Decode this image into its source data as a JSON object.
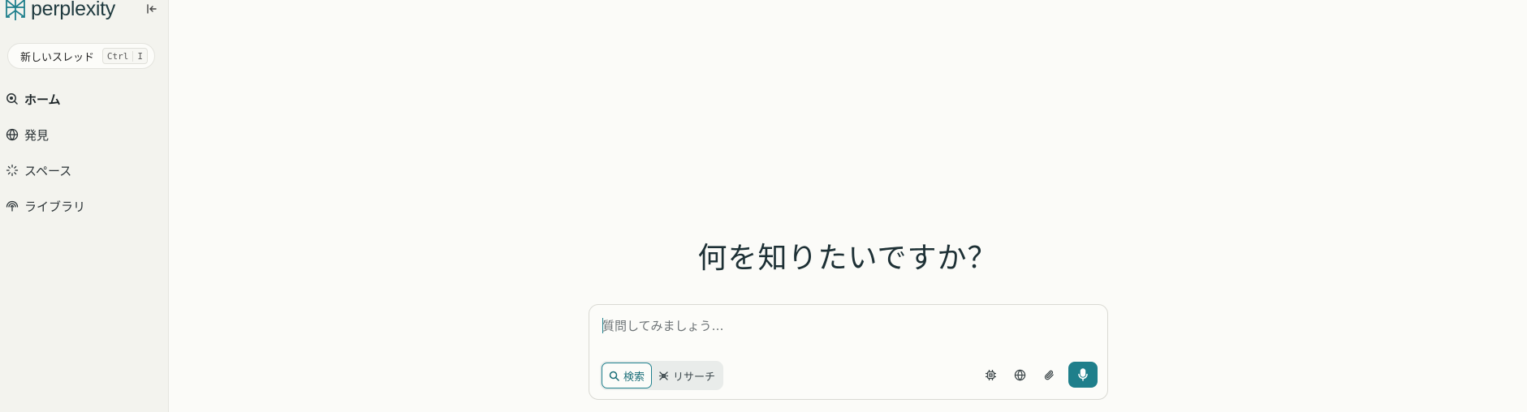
{
  "brand": {
    "name": "perplexity",
    "accent": "#20808d"
  },
  "sidebar": {
    "new_thread": {
      "label": "新しいスレッド",
      "shortcut": [
        "Ctrl",
        "I"
      ]
    },
    "items": [
      {
        "label": "ホーム",
        "icon": "search-circle-icon",
        "active": true
      },
      {
        "label": "発見",
        "icon": "globe-icon",
        "active": false
      },
      {
        "label": "スペース",
        "icon": "sparkle-icon",
        "active": false
      },
      {
        "label": "ライブラリ",
        "icon": "library-icon",
        "active": false
      }
    ]
  },
  "main": {
    "headline": "何を知りたいですか？",
    "composer": {
      "placeholder": "質問してみましょう…",
      "modes": [
        {
          "label": "検索",
          "icon": "search-icon",
          "active": true
        },
        {
          "label": "リサーチ",
          "icon": "research-icon",
          "active": false
        }
      ],
      "tools": [
        "model-chip-icon",
        "globe-icon",
        "paperclip-icon",
        "microphone-icon"
      ]
    }
  }
}
